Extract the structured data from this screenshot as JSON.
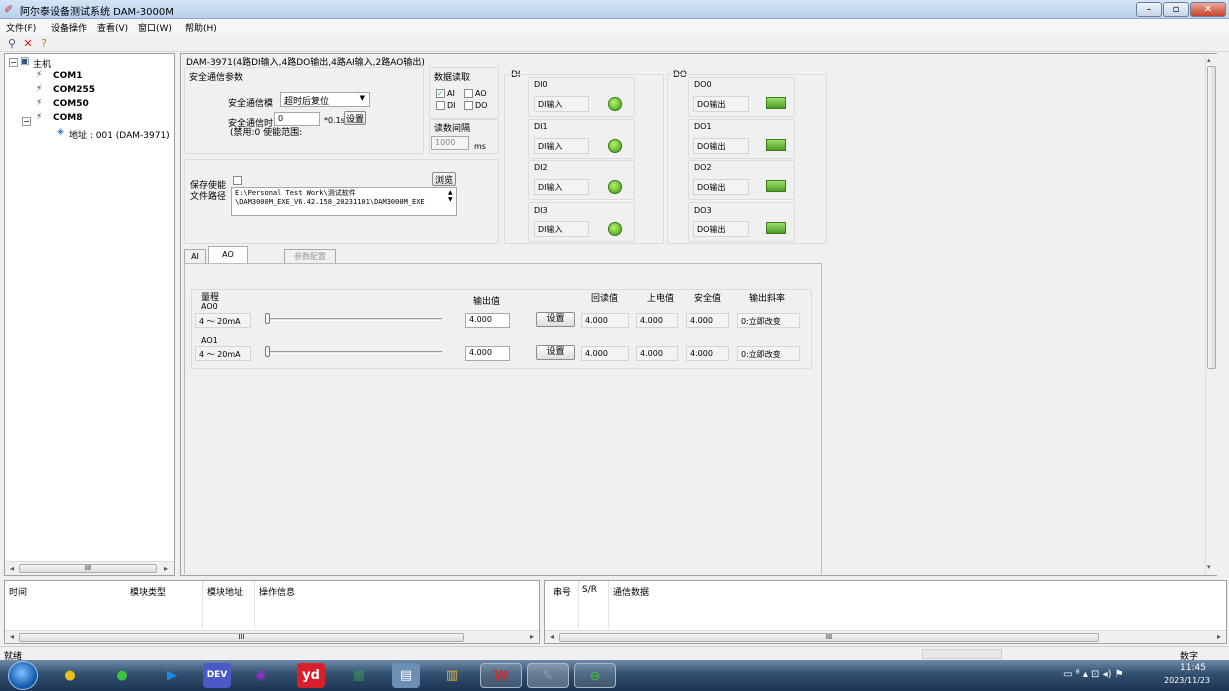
{
  "window": {
    "title": "阿尔泰设备测试系统 DAM-3000M"
  },
  "menu": [
    "文件(F)",
    "设备操作",
    "查看(V)",
    "窗口(W)",
    "帮助(H)"
  ],
  "tree": {
    "root": "主机",
    "ports": [
      "COM1",
      "COM255",
      "COM50",
      "COM8"
    ],
    "device": "地址 : 001 (DAM-3971)",
    "scroll_glyph": "III"
  },
  "main": {
    "device_title": "DAM-3971(4路DI输入,4路DO输出,4路AI输入,2路AO输出)",
    "safety": {
      "group_title": "安全通信参数",
      "mode_label": "安全通信模",
      "mode_value": "超时后复位",
      "time_label": "安全通信时",
      "time_value": "0",
      "time_unit": "*0.1s",
      "set_button": "设置",
      "note": "(禁用:0 使能范围:"
    },
    "data_read": {
      "group_title": "数据读取",
      "options": [
        {
          "label": "AI",
          "checked": true
        },
        {
          "label": "AO",
          "checked": false
        },
        {
          "label": "DI",
          "checked": false
        },
        {
          "label": "DO",
          "checked": false
        }
      ],
      "interval_title": "读数间隔",
      "interval_value": "1000",
      "interval_unit": "ms"
    },
    "save": {
      "enable_label": "保存使能",
      "browse_button": "浏览",
      "path_label": "文件路径",
      "path_line1": "E:\\Personal Test Work\\测试软件",
      "path_line2": "\\DAM3000M_EXE_V6.42.158_20231101\\DAM3000M_EXE"
    },
    "di": {
      "section": "DI",
      "channels": [
        {
          "name": "DI0",
          "label": "DI输入"
        },
        {
          "name": "DI1",
          "label": "DI输入"
        },
        {
          "name": "DI2",
          "label": "DI输入"
        },
        {
          "name": "DI3",
          "label": "DI输入"
        }
      ]
    },
    "do": {
      "section": "DO",
      "channels": [
        {
          "name": "DO0",
          "label": "DO输出"
        },
        {
          "name": "DO1",
          "label": "DO输出"
        },
        {
          "name": "DO2",
          "label": "DO输出"
        },
        {
          "name": "DO3",
          "label": "DO输出"
        }
      ]
    },
    "tabs": [
      "AI",
      "AO",
      "参数配置"
    ],
    "ao": {
      "headers": {
        "range": "量程",
        "output": "输出值",
        "readback": "回读值",
        "power_on": "上电值",
        "safe": "安全值",
        "slope": "输出斜率"
      },
      "rows": [
        {
          "name": "AO0",
          "range": "4 ～ 20mA",
          "output": "4.000",
          "set": "设置",
          "readback": "4.000",
          "power_on": "4.000",
          "safe": "4.000",
          "slope": "0:立即改变"
        },
        {
          "name": "AO1",
          "range": "4 ～ 20mA",
          "output": "4.000",
          "set": "设置",
          "readback": "4.000",
          "power_on": "4.000",
          "safe": "4.000",
          "slope": "0:立即改变"
        }
      ]
    }
  },
  "log_left": {
    "headers": [
      "时间",
      "模块类型",
      "模块地址",
      "操作信息"
    ],
    "scroll_glyph": "III"
  },
  "log_right": {
    "headers": [
      "串号",
      "S/R",
      "通信数据"
    ],
    "scroll_glyph": "III"
  },
  "status": {
    "left": "就绪",
    "right": "数字"
  },
  "taskbar": {
    "apps": [
      {
        "name": "qq",
        "glyph": "●",
        "color": "#e8c11e"
      },
      {
        "name": "wechat",
        "glyph": "●",
        "color": "#3ec43e"
      },
      {
        "name": "arrow-app",
        "glyph": "▶",
        "color": "#1e88e5"
      },
      {
        "name": "dev",
        "glyph": "DEV",
        "color": "#4b59c7"
      },
      {
        "name": "eye-app",
        "glyph": "◉",
        "color": "#8e2fbf"
      },
      {
        "name": "youdao",
        "glyph": "yd",
        "color": "#d8202c"
      },
      {
        "name": "monitor-app",
        "glyph": "▦",
        "color": "#3a8a5a"
      },
      {
        "name": "calculator",
        "glyph": "▤",
        "color": "#6d8fb3"
      },
      {
        "name": "explorer",
        "glyph": "▥",
        "color": "#e0b84a"
      },
      {
        "name": "wps",
        "glyph": "W",
        "color": "#c92f2f"
      },
      {
        "name": "dam-app",
        "glyph": "✎",
        "color": "#9aa4b0"
      },
      {
        "name": "360",
        "glyph": "⊖",
        "color": "#3fb33f"
      }
    ],
    "time": "11:45",
    "date": "2023/11/23"
  }
}
